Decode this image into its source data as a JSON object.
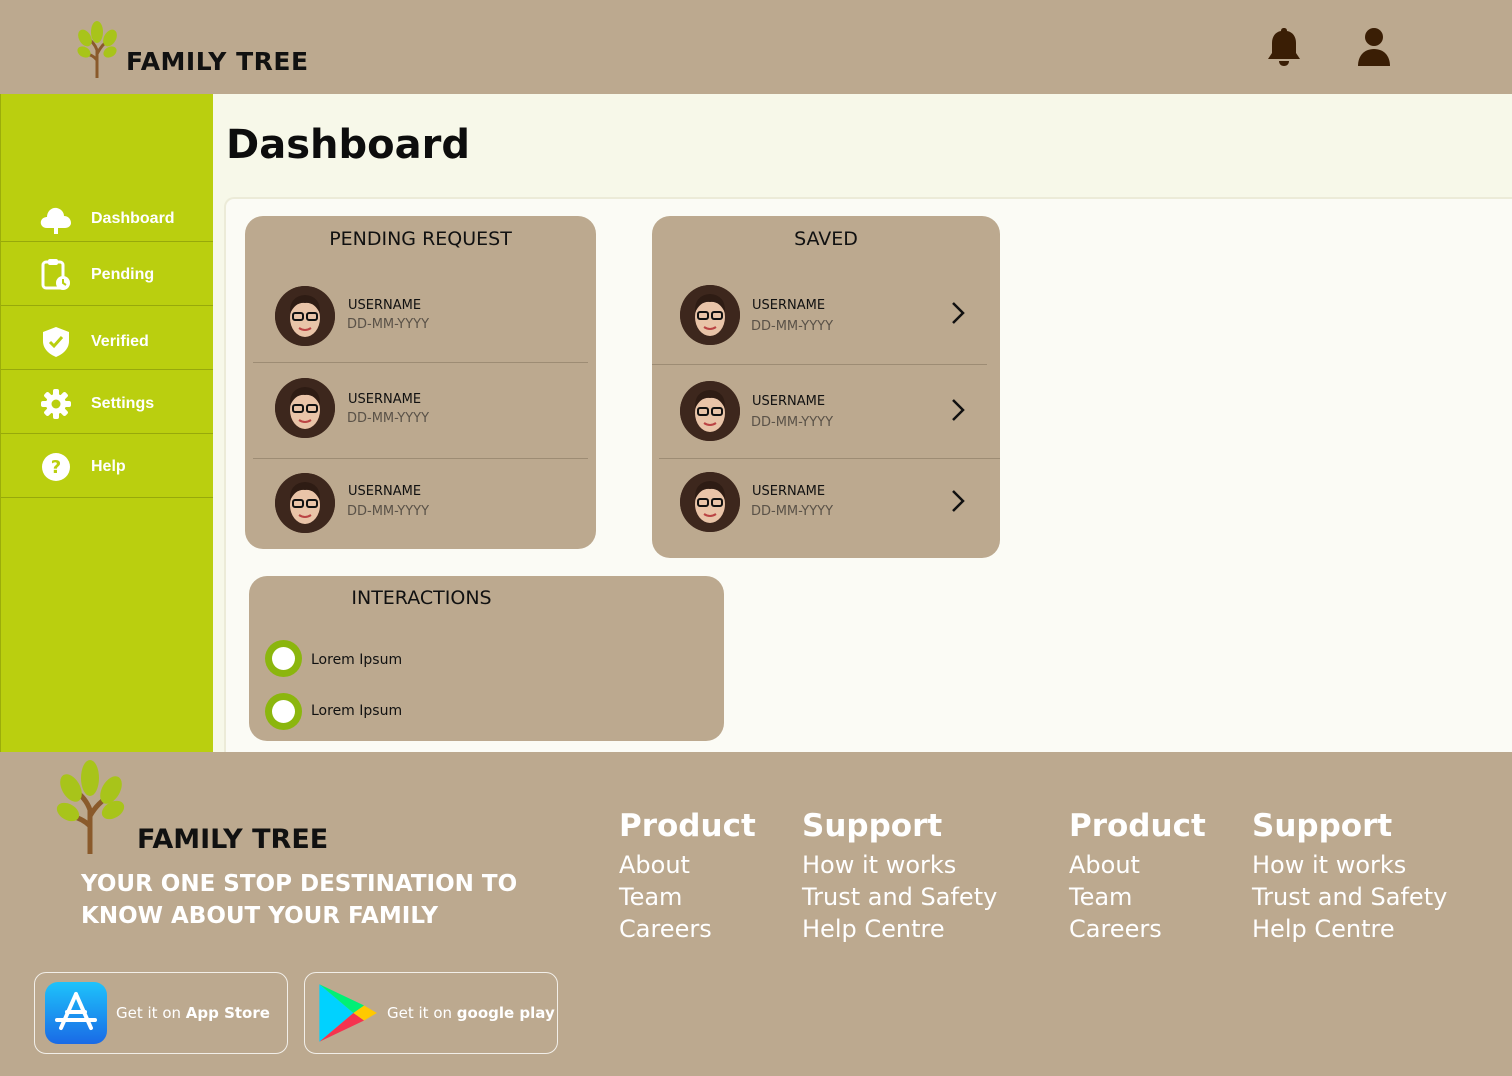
{
  "header": {
    "app_name": "FAMILY TREE"
  },
  "sidebar": {
    "items": [
      {
        "label": "Dashboard",
        "icon": "cloud-icon"
      },
      {
        "label": "Pending",
        "icon": "clipboard-clock-icon"
      },
      {
        "label": "Verified",
        "icon": "shield-check-icon"
      },
      {
        "label": "Settings",
        "icon": "gear-icon"
      },
      {
        "label": "Help",
        "icon": "help-icon"
      }
    ]
  },
  "main": {
    "title": "Dashboard",
    "pending": {
      "title": "PENDING REQUEST",
      "rows": [
        {
          "username": "USERNAME",
          "date": "DD-MM-YYYY"
        },
        {
          "username": "USERNAME",
          "date": "DD-MM-YYYY"
        },
        {
          "username": "USERNAME",
          "date": "DD-MM-YYYY"
        }
      ]
    },
    "saved": {
      "title": "SAVED",
      "rows": [
        {
          "username": "USERNAME",
          "date": "DD-MM-YYYY"
        },
        {
          "username": "USERNAME",
          "date": "DD-MM-YYYY"
        },
        {
          "username": "USERNAME",
          "date": "DD-MM-YYYY"
        }
      ]
    },
    "interactions": {
      "title": "INTERACTIONS",
      "items": [
        "Lorem Ipsum",
        "Lorem Ipsum"
      ]
    }
  },
  "footer": {
    "app_name": "FAMILY TREE",
    "tagline": "YOUR ONE STOP DESTINATION TO KNOW ABOUT YOUR FAMILY",
    "columns": [
      {
        "heading": "Product",
        "links": [
          "About",
          "Team",
          "Careers"
        ]
      },
      {
        "heading": "Support",
        "links": [
          "How it works",
          "Trust and Safety",
          "Help Centre"
        ]
      },
      {
        "heading": "Product",
        "links": [
          "About",
          "Team",
          "Careers"
        ]
      },
      {
        "heading": "Support",
        "links": [
          "How it works",
          "Trust and Safety",
          "Help Centre"
        ]
      }
    ],
    "app_store": {
      "prefix": "Get it on ",
      "name": "App Store"
    },
    "google_play": {
      "prefix": "Get it on ",
      "name": "google play"
    }
  },
  "colors": {
    "header_bg": "#bca98f",
    "sidebar_bg": "#bacf0f",
    "main_bg": "#f7f8e9",
    "card_bg": "#bca98f",
    "radio_accent": "#8bb60e",
    "icon_dark": "#3a1e05"
  }
}
